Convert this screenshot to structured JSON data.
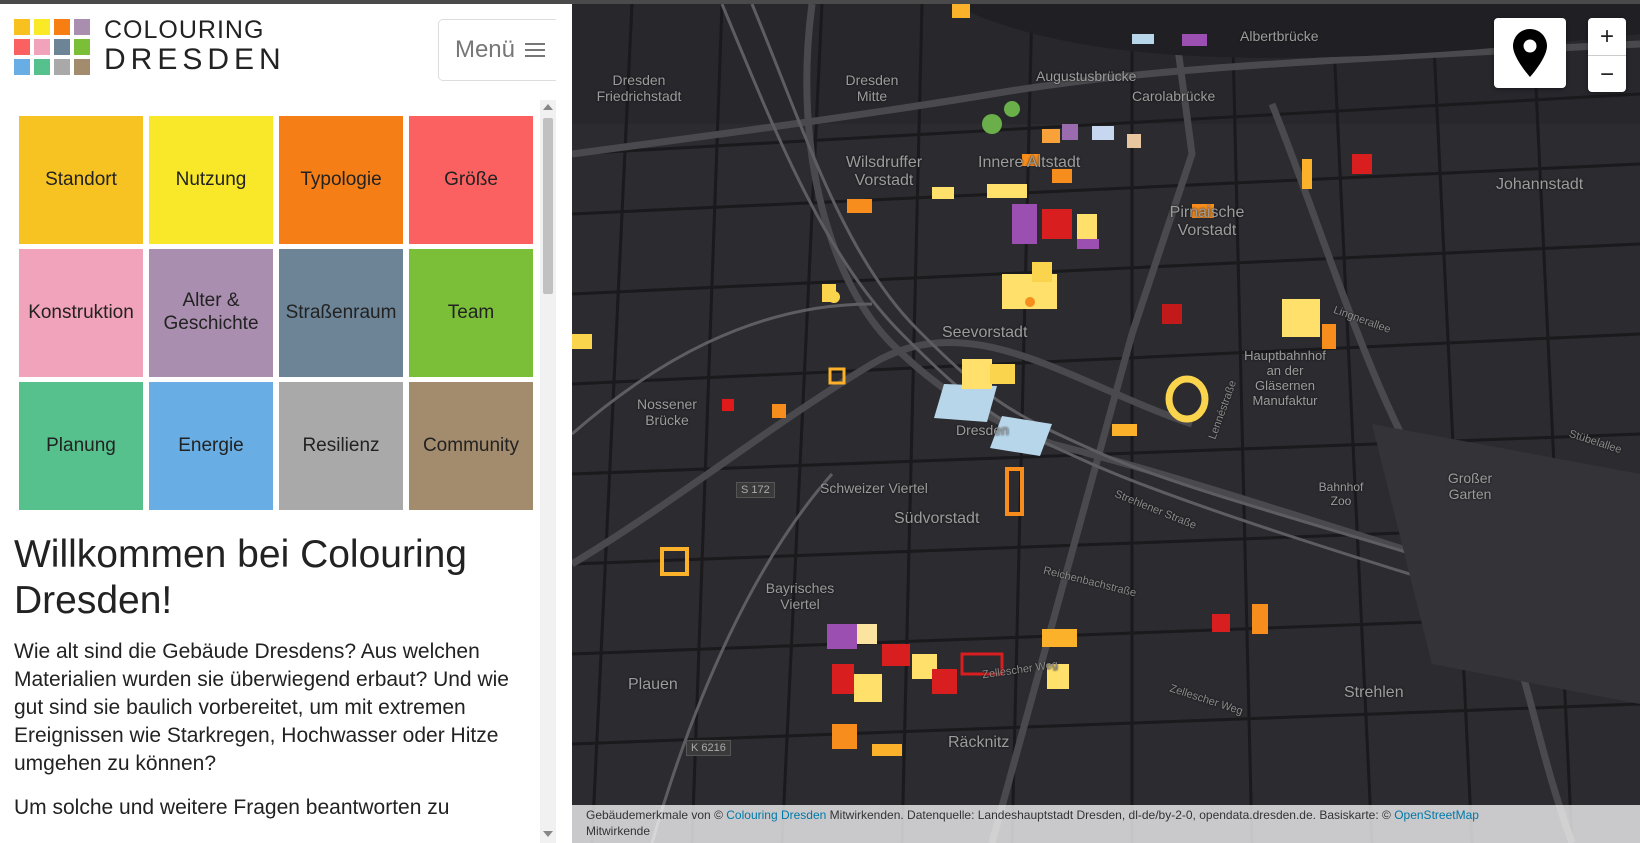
{
  "logo": {
    "line1": "COLOURING",
    "line2": "DRESDEN",
    "colors": [
      "#f8c11f",
      "#f9e926",
      "#f77e13",
      "#d99a9a",
      "#f2a2bb",
      "#d19fcd",
      "#6f8ba1",
      "#7cbf2b",
      "#46b3a1",
      "#5fa6e5",
      "#aaaaaa",
      "#a48b6a"
    ]
  },
  "menu_button": {
    "label": "Menü"
  },
  "categories": [
    {
      "label": "Standort",
      "color": "#f7c322"
    },
    {
      "label": "Nutzung",
      "color": "#f8e829"
    },
    {
      "label": "Typologie",
      "color": "#f57f16"
    },
    {
      "label": "Größe",
      "color": "#fc6161"
    },
    {
      "label": "Konstruktion",
      "color": "#f1a3bb"
    },
    {
      "label": "Alter & Geschichte",
      "color": "#a98eaf"
    },
    {
      "label": "Straßenraum",
      "color": "#6d8497"
    },
    {
      "label": "Team",
      "color": "#7bbf38"
    },
    {
      "label": "Planung",
      "color": "#56c18d"
    },
    {
      "label": "Energie",
      "color": "#68ade3"
    },
    {
      "label": "Resilienz",
      "color": "#a9a9a9"
    },
    {
      "label": "Community",
      "color": "#a38c6d"
    }
  ],
  "welcome": {
    "title": "Willkommen bei Colouring Dresden!",
    "paragraph1": "Wie alt sind die Gebäude Dresdens? Aus welchen Materialien wurden sie überwiegend erbaut? Und wie gut sind sie baulich vorbereitet, um mit extremen Ereignissen wie Starkregen, Hochwasser oder Hitze umgehen zu können?",
    "paragraph2": "Um solche und weitere Fragen beantworten zu"
  },
  "map": {
    "labels": [
      "Albertbrücke",
      "Augustusbrücke",
      "Carolabrücke",
      "Dresden Friedrichstadt",
      "Dresden Mitte",
      "Wilsdruffer Vorstadt",
      "Innere Altstadt",
      "Pirnaische Vorstadt",
      "Johannstadt",
      "Seevorstadt",
      "Hauptbahnhof an der Gläsernen Manufaktur",
      "Nossener Brücke",
      "Dresden",
      "Schweizer Viertel",
      "Südvorstadt",
      "Großer Garten",
      "Bahnhof Zoo",
      "Bayrisches Viertel",
      "Plauen",
      "Strehlen",
      "Räcknitz"
    ],
    "road_labels": [
      "Strehlener Straße",
      "Reichenbachstraße",
      "Zellescher Weg",
      "Zellescher Weg",
      "Lennéstraße",
      "Stübelallee",
      "Lingnerallee"
    ],
    "shields": [
      "S 172",
      "K 6216"
    ],
    "location_icon": "map-pin-icon",
    "zoom_in": "+",
    "zoom_out": "−"
  },
  "attribution": {
    "prefix": "Gebäudemerkmale von ©",
    "link1": "Colouring Dresden",
    "middle": "Mitwirkenden. Datenquelle: Landeshauptstadt Dresden, dl-de/by-2-0, opendata.dresden.de. Basiskarte: ©",
    "link2": "OpenStreetMap",
    "suffix": "Mitwirkende"
  }
}
